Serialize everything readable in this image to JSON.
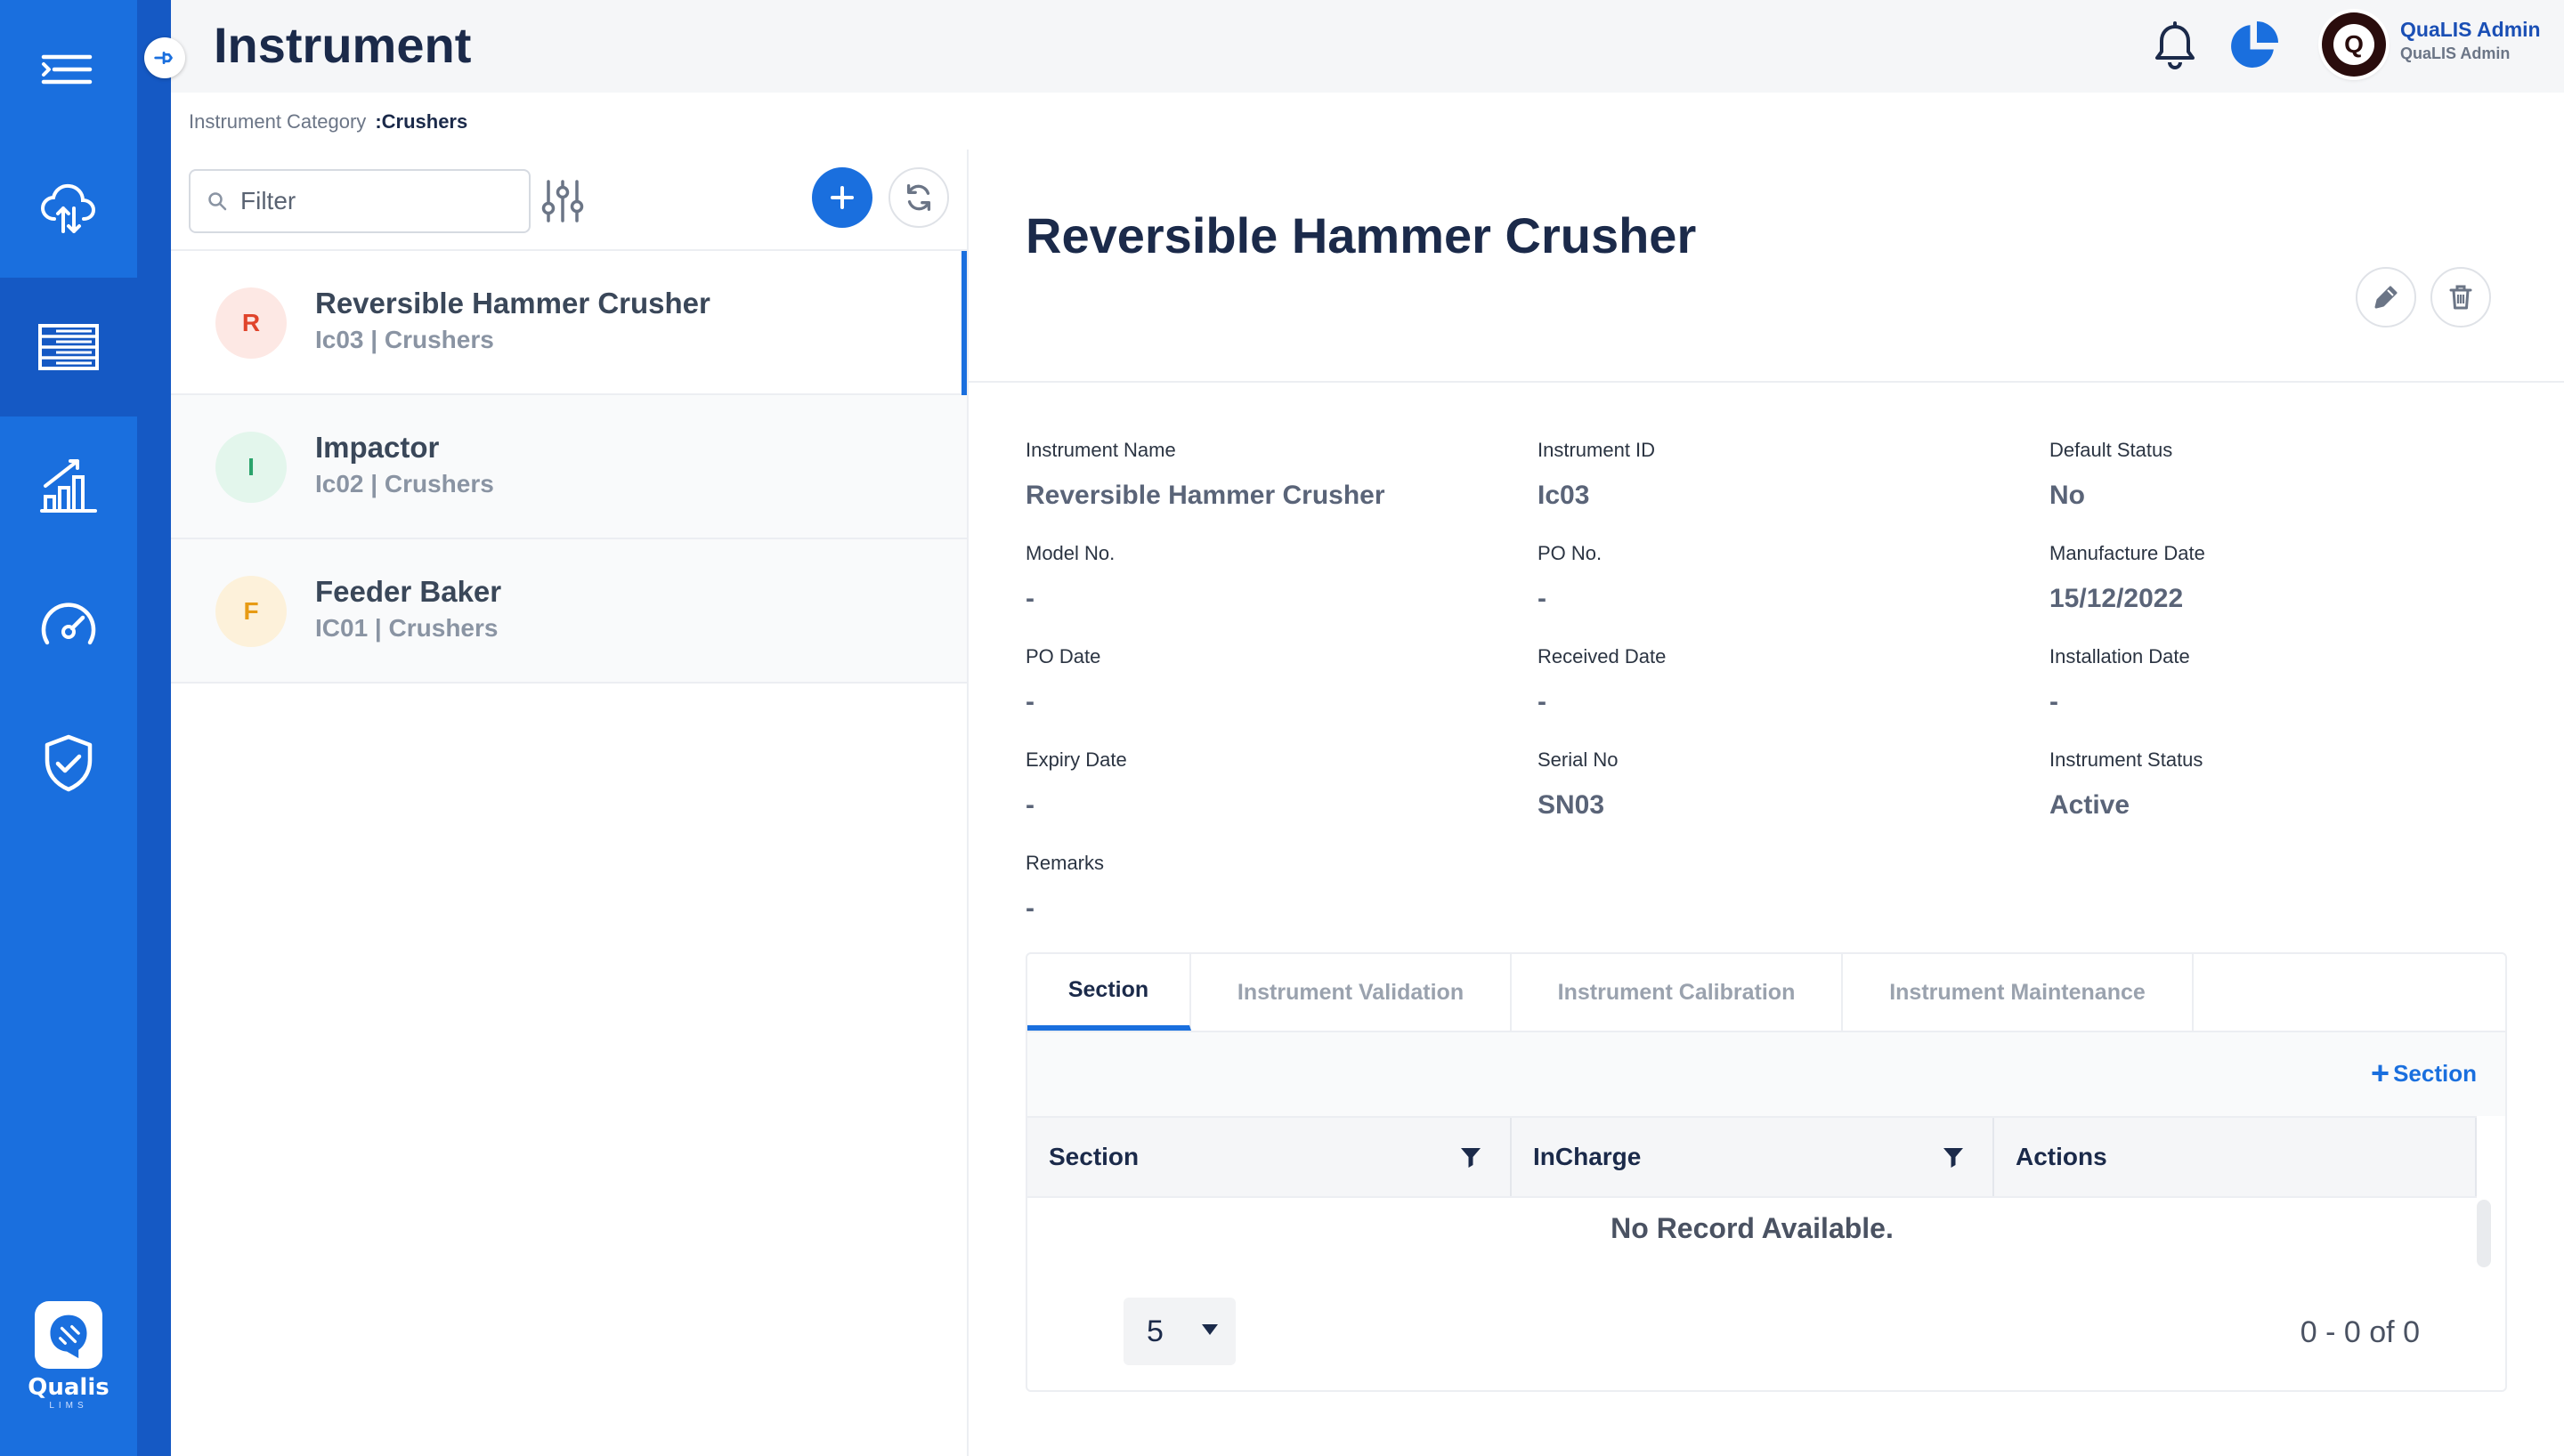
{
  "header": {
    "title": "Instrument",
    "user_name": "QuaLIS Admin",
    "user_role": "QuaLIS Admin",
    "avatar_initial": "Q"
  },
  "sidebar": {
    "items": [
      {
        "icon": "menu-icon"
      },
      {
        "icon": "cloud-sync-icon"
      },
      {
        "icon": "list-icon",
        "active": true
      },
      {
        "icon": "chart-growth-icon"
      },
      {
        "icon": "gauge-icon"
      },
      {
        "icon": "shield-check-icon"
      }
    ],
    "logo_text": "Qualis",
    "logo_sub": "LIMS"
  },
  "breadcrumb": {
    "label": "Instrument Category",
    "value": ":Crushers"
  },
  "list": {
    "filter_placeholder": "Filter",
    "items": [
      {
        "initial": "R",
        "title": "Reversible Hammer Crusher",
        "subtitle": "Ic03 | Crushers",
        "color": "#e0442b",
        "bg": "#fde8e4"
      },
      {
        "initial": "I",
        "title": "Impactor",
        "subtitle": "Ic02 | Crushers",
        "color": "#2aa36b",
        "bg": "#e3f6ec"
      },
      {
        "initial": "F",
        "title": "Feeder Baker",
        "subtitle": "IC01 | Crushers",
        "color": "#e79b14",
        "bg": "#fdf1da"
      }
    ]
  },
  "detail": {
    "title": "Reversible Hammer Crusher",
    "fields": {
      "instrument_name": {
        "label": "Instrument Name",
        "value": "Reversible Hammer Crusher"
      },
      "instrument_id": {
        "label": "Instrument ID",
        "value": "Ic03"
      },
      "default_status": {
        "label": "Default Status",
        "value": "No"
      },
      "model_no": {
        "label": "Model No.",
        "value": "-"
      },
      "po_no": {
        "label": "PO No.",
        "value": "-"
      },
      "manufacture_date": {
        "label": "Manufacture Date",
        "value": "15/12/2022"
      },
      "po_date": {
        "label": "PO Date",
        "value": "-"
      },
      "received_date": {
        "label": "Received Date",
        "value": "-"
      },
      "installation_date": {
        "label": "Installation Date",
        "value": "-"
      },
      "expiry_date": {
        "label": "Expiry Date",
        "value": "-"
      },
      "serial_no": {
        "label": "Serial No",
        "value": "SN03"
      },
      "instrument_status": {
        "label": "Instrument Status",
        "value": "Active"
      },
      "remarks": {
        "label": "Remarks",
        "value": "-"
      }
    }
  },
  "tabs": [
    {
      "label": "Section",
      "active": true
    },
    {
      "label": "Instrument Validation"
    },
    {
      "label": "Instrument Calibration"
    },
    {
      "label": "Instrument Maintenance"
    }
  ],
  "table": {
    "add_label": "Section",
    "columns": [
      "Section",
      "InCharge",
      "Actions"
    ],
    "empty_text": "No Record Available.",
    "page_size": "5",
    "range_text": "0 - 0 of 0"
  },
  "colors": {
    "accent": "#1a6fde",
    "rail_dark": "#1559c4",
    "title": "#1b2a4a"
  }
}
